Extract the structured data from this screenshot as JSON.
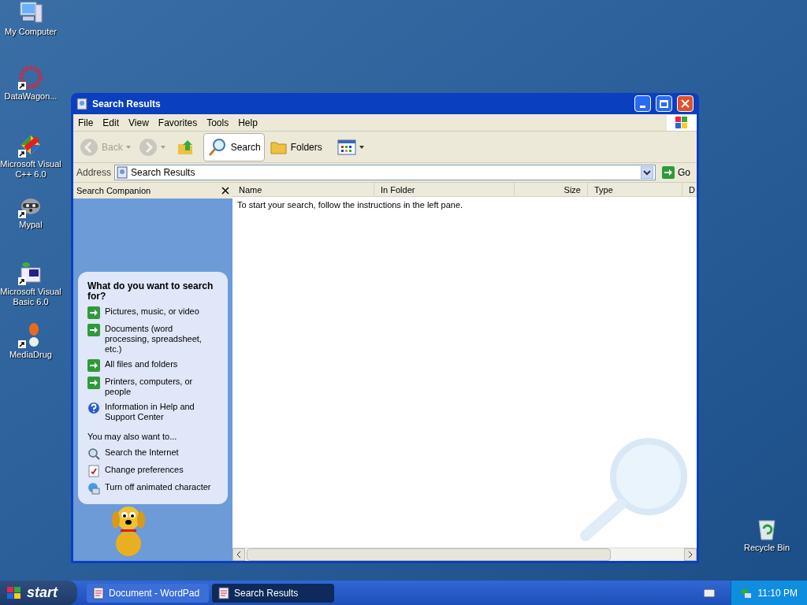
{
  "desktop_icons": [
    {
      "label": "My Computer",
      "kind": "computer",
      "shortcut": false
    },
    {
      "label": "DataWagon...",
      "kind": "flower",
      "shortcut": true
    },
    {
      "label": "Microsoft Visual C++ 6.0",
      "kind": "cpp",
      "shortcut": true
    },
    {
      "label": "Mypal",
      "kind": "raccoon",
      "shortcut": true
    },
    {
      "label": "Microsoft Visual Basic 6.0",
      "kind": "vb",
      "shortcut": true
    },
    {
      "label": "MediaDrug",
      "kind": "pill",
      "shortcut": true
    },
    {
      "label": "Recycle Bin",
      "kind": "bin",
      "shortcut": false
    }
  ],
  "window": {
    "title": "Search Results"
  },
  "menu": [
    "File",
    "Edit",
    "View",
    "Favorites",
    "Tools",
    "Help"
  ],
  "toolbar": [
    {
      "kind": "back",
      "label": "Back",
      "disabled": true
    },
    {
      "kind": "forward",
      "disabled": true
    },
    {
      "kind": "up",
      "disabled": false
    },
    {
      "kind": "search",
      "label": "Search",
      "selected": true
    },
    {
      "kind": "folders",
      "label": "Folders",
      "selected": false
    },
    {
      "kind": "views",
      "disabled": false
    }
  ],
  "address": {
    "label": "Address",
    "value": "Search Results",
    "go": "Go"
  },
  "companion": {
    "title": "Search Companion",
    "heading": "What do you want to search for?",
    "options": [
      {
        "kind": "arrow",
        "label": "Pictures, music, or video"
      },
      {
        "kind": "arrow",
        "label": "Documents (word processing, spreadsheet, etc.)"
      },
      {
        "kind": "arrow",
        "label": "All files and folders"
      },
      {
        "kind": "arrow",
        "label": "Printers, computers, or people"
      },
      {
        "kind": "help",
        "label": "Information in Help and Support Center"
      }
    ],
    "subheading": "You may also want to...",
    "more": [
      {
        "kind": "internet",
        "label": "Search the Internet"
      },
      {
        "kind": "prefs",
        "label": "Change preferences"
      },
      {
        "kind": "character",
        "label": "Turn off animated character"
      }
    ]
  },
  "columns": [
    "Name",
    "In Folder",
    "Size",
    "Type",
    "D"
  ],
  "message": "To start your search, follow the instructions in the left pane.",
  "taskbar": {
    "start": "start",
    "tasks": [
      {
        "label": "Document - WordPad",
        "selected": false
      },
      {
        "label": "Search Results",
        "selected": true
      }
    ],
    "clock": "11:10 PM"
  }
}
